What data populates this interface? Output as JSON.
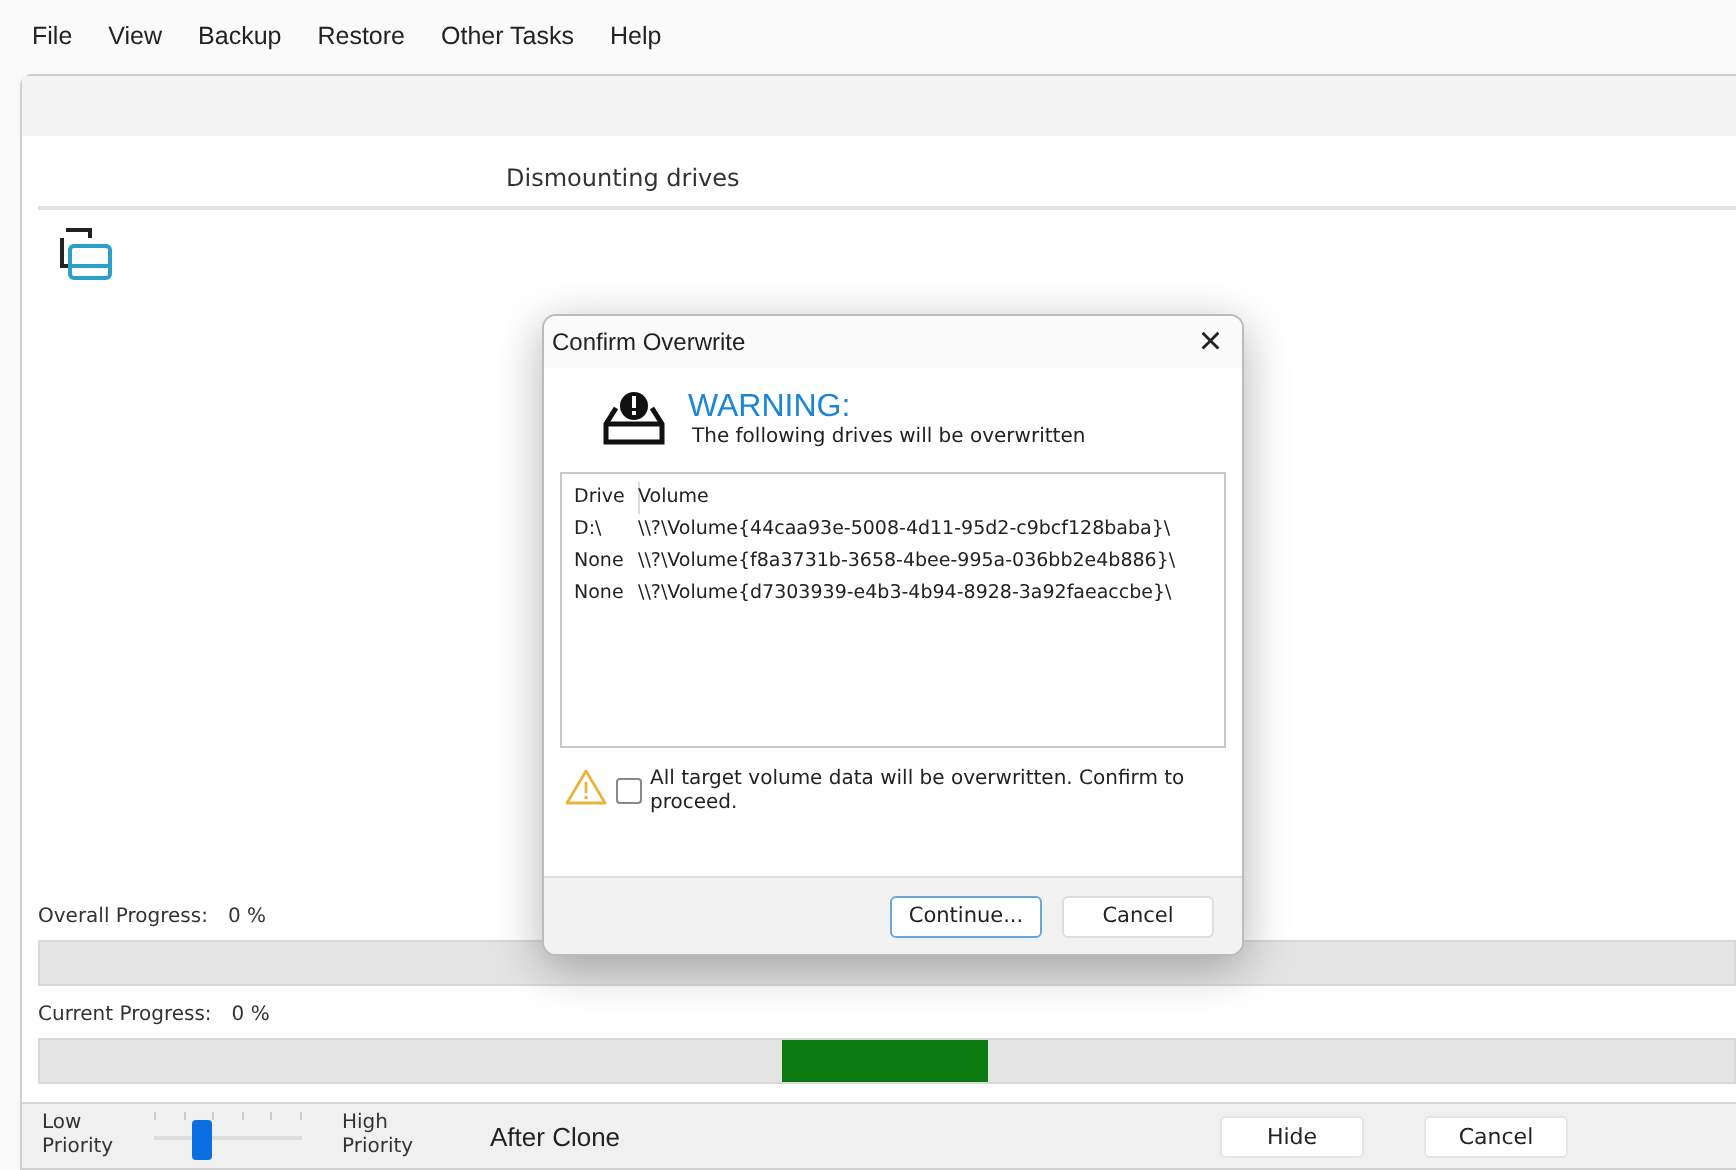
{
  "menu": [
    "File",
    "View",
    "Backup",
    "Restore",
    "Other Tasks",
    "Help"
  ],
  "status": "Dismounting drives",
  "overall_progress": {
    "label": "Overall Progress:",
    "reading": "0 %"
  },
  "current_progress": {
    "label": "Current Progress:",
    "reading": "0 %"
  },
  "priority": {
    "low_label": "Low Priority",
    "high_label": "High Priority",
    "level": 0.33
  },
  "after_clone": "After Clone",
  "buttons": [
    "Hide",
    "Cancel"
  ],
  "dialog": {
    "title": "Confirm Overwrite",
    "close": "×",
    "heading": "WARNING:",
    "subheading": "The following drives will be overwritten",
    "table": {
      "columns": [
        "Drive",
        "Volume"
      ],
      "rows": [
        [
          "D:\\",
          "\\\\?\\Volume{44caa93e-5008-4d11-95d2-c9bcf128baba}\\"
        ],
        [
          "None",
          "\\\\?\\Volume{f8a3731b-3658-4bee-995a-036bb2e4b886}\\"
        ],
        [
          "None",
          "\\\\?\\Volume{d7303939-e4b3-4b94-8928-3a92faeaccbe}\\"
        ]
      ]
    },
    "confirm": {
      "label": "All target volume data will be overwritten. Confirm to proceed.",
      "checked": false
    },
    "buttons": [
      {
        "label": "Continue...",
        "selected": true
      },
      {
        "label": "Cancel",
        "selected": false
      }
    ]
  }
}
